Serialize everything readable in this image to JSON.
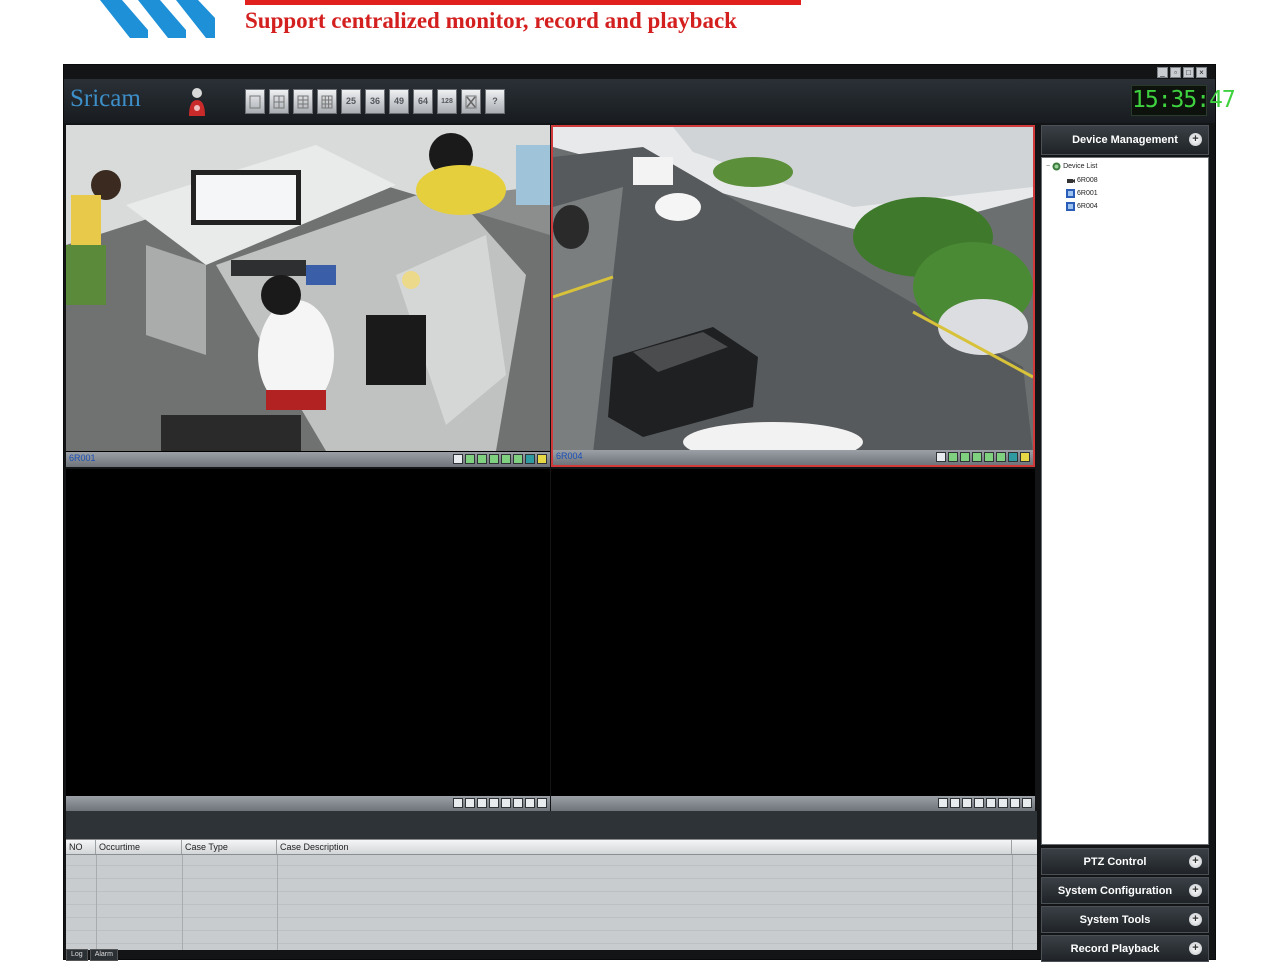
{
  "banner": {
    "text": "Support centralized monitor, record and playback",
    "accent_color": "#d41f1f",
    "logo_color": "#1e90d8"
  },
  "window": {
    "title": "Sricam",
    "clock": "15:35:47",
    "controls": [
      "minimize",
      "restore",
      "maximize",
      "close"
    ]
  },
  "toolbar": {
    "user_icon": "user-icon",
    "layout_buttons": [
      {
        "id": "layout-1",
        "label": "",
        "icon": "single-view-icon"
      },
      {
        "id": "layout-4",
        "label": "",
        "icon": "grid-4-icon"
      },
      {
        "id": "layout-6",
        "label": "",
        "icon": "grid-6-icon"
      },
      {
        "id": "layout-9",
        "label": "",
        "icon": "grid-9-icon"
      },
      {
        "id": "layout-25",
        "label": "25",
        "icon": ""
      },
      {
        "id": "layout-36",
        "label": "36",
        "icon": ""
      },
      {
        "id": "layout-49",
        "label": "49",
        "icon": ""
      },
      {
        "id": "layout-64",
        "label": "64",
        "icon": ""
      },
      {
        "id": "layout-128",
        "label": "128",
        "icon": ""
      },
      {
        "id": "fullscreen",
        "label": "",
        "icon": "fullscreen-icon"
      },
      {
        "id": "help",
        "label": "?",
        "icon": "help-icon"
      }
    ]
  },
  "video_panes": [
    {
      "label": "6R001",
      "selected": false,
      "feed": "office"
    },
    {
      "label": "6R004",
      "selected": true,
      "feed": "street"
    },
    {
      "label": "",
      "selected": false,
      "feed": "empty"
    },
    {
      "label": "",
      "selected": false,
      "feed": "empty"
    }
  ],
  "log": {
    "columns": [
      "NO",
      "Occurtime",
      "Case Type",
      "Case Description"
    ],
    "rows": []
  },
  "bottom_tabs": [
    "Log",
    "Alarm"
  ],
  "right_panel": {
    "device_management": {
      "title": "Device Management",
      "tree": {
        "root": "Device List",
        "children": [
          "6R008",
          "6R001",
          "6R004"
        ]
      }
    },
    "sections": [
      "PTZ Control",
      "System Configuration",
      "System Tools",
      "Record Playback"
    ]
  }
}
